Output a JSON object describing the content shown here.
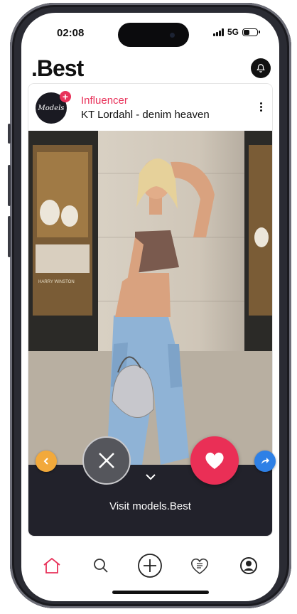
{
  "status_bar": {
    "time": "02:08",
    "network": "5G",
    "battery_level": 0.4
  },
  "header": {
    "logo": ".Best"
  },
  "post": {
    "category": "Influencer",
    "title": "KT Lordahl - denim heaven",
    "avatar_text": "Models",
    "photo_store_sign": "HARRY WINSTON"
  },
  "actions": {
    "visit_label": "Visit models.Best"
  },
  "colors": {
    "accent": "#e8325a",
    "back": "#f2a93b",
    "share": "#2e80e6",
    "bar": "#22222b"
  },
  "tabs": [
    {
      "icon": "home-icon",
      "active": true
    },
    {
      "icon": "search-icon",
      "active": false
    },
    {
      "icon": "add-icon",
      "active": false
    },
    {
      "icon": "favorites-list-icon",
      "active": false
    },
    {
      "icon": "profile-icon",
      "active": false
    }
  ]
}
